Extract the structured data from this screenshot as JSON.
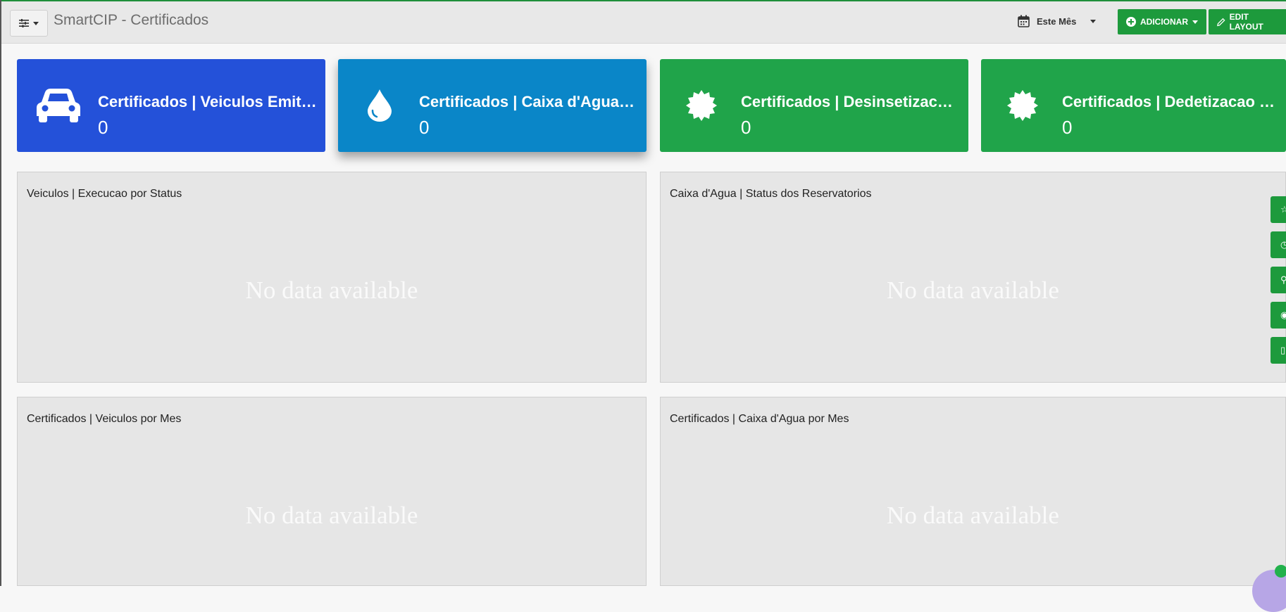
{
  "header": {
    "title": "SmartCIP - Certificados",
    "date_filter": "Este Mês",
    "add_label": "ADICIONAR",
    "edit_label": "EDIT LAYOUT"
  },
  "cards": [
    {
      "title": "Certificados | Veiculos Emitidos",
      "value": "0",
      "icon": "car-icon",
      "color": "#2451d9"
    },
    {
      "title": "Certificados | Caixa d'Agua Emitidos",
      "value": "0",
      "icon": "water-drop-icon",
      "color": "#0a86c8"
    },
    {
      "title": "Certificados | Desinsetizacao Emitidos",
      "value": "0",
      "icon": "certificate-badge-icon",
      "color": "#20a44a"
    },
    {
      "title": "Certificados | Dedetizacao Emitidos",
      "value": "0",
      "icon": "certificate-badge-icon",
      "color": "#20a44a"
    }
  ],
  "panels": [
    {
      "title": "Veiculos | Execucao por Status",
      "empty": "No data available"
    },
    {
      "title": "Caixa d'Agua | Status dos Reservatorios",
      "empty": "No data available"
    },
    {
      "title": "Certificados | Veiculos por Mes",
      "empty": "No data available"
    },
    {
      "title": "Certificados | Caixa d'Agua por Mes",
      "empty": "No data available"
    }
  ],
  "side_actions": [
    "star-icon",
    "clock-icon",
    "pin-icon",
    "eye-icon",
    "document-icon"
  ]
}
